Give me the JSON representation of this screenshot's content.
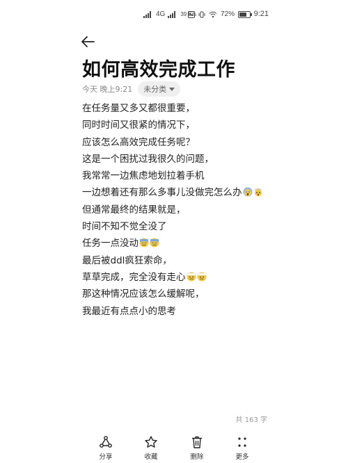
{
  "status_bar": {
    "network": "4G",
    "speed": "39 K/s",
    "battery_text": "72%",
    "battery_level": 0.72,
    "time": "9:21"
  },
  "note": {
    "title": "如何高效完成工作",
    "date": "今天 晚上9:21",
    "category": "未分类",
    "lines": [
      {
        "text": "在任务量又多又都很重要，",
        "emoji": []
      },
      {
        "text": "同时时间又很紧的情况下，",
        "emoji": []
      },
      {
        "text": "应该怎么高效完成任务呢？",
        "emoji": []
      },
      {
        "text": "这是一个困扰过我很久的问题，",
        "emoji": []
      },
      {
        "text": "我常常一边焦虑地划拉着手机",
        "emoji": []
      },
      {
        "text": "一边想着还有那么多事儿没做完怎么办",
        "emoji": [
          "screaming-face",
          "exploding-head"
        ]
      },
      {
        "text": "但通常最终的结果就是，",
        "emoji": []
      },
      {
        "text": "时间不知不觉全没了",
        "emoji": []
      },
      {
        "text": "任务一点没动",
        "emoji": [
          "anxious-face",
          "anxious-face"
        ]
      },
      {
        "text": "最后被ddl疯狂索命，",
        "emoji": []
      },
      {
        "text": "草草完成，完全没有走心",
        "emoji": [
          "bandage-face",
          "bandage-face"
        ]
      },
      {
        "text": "那这种情况应该怎么缓解呢，",
        "emoji": []
      },
      {
        "text": "我最近有点点小的思考",
        "emoji": []
      }
    ],
    "word_count": "共 163 字"
  },
  "bottom_bar": {
    "share": "分享",
    "favorite": "收藏",
    "delete": "删除",
    "more": "更多"
  }
}
